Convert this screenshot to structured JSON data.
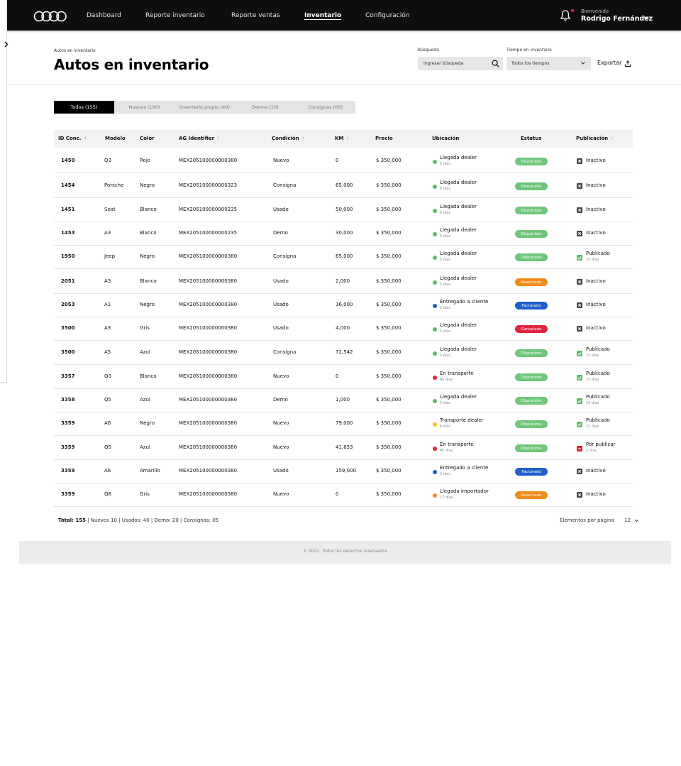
{
  "nav": {
    "items": [
      "Dashboard",
      "Reporte inventario",
      "Reporte ventas",
      "Inventario",
      "Configuración"
    ],
    "active": "Inventario",
    "welcome": "Bienvenido",
    "user_name": "Rodrigo Fernández"
  },
  "header": {
    "breadcrumb": "Autos en inventario",
    "title": "Autos en inventario",
    "search_label": "Búsqueda",
    "search_placeholder": "Ingresar búsqueda",
    "time_label": "Tiempo en inventario",
    "time_value": "Todos los tiempos",
    "export_label": "Exportar"
  },
  "tabs": [
    {
      "label": "Todos (155)",
      "active": true
    },
    {
      "label": "Nuevos (100)",
      "active": false
    },
    {
      "label": "Inventario propio (40)",
      "active": false
    },
    {
      "label": "Demos  (10)",
      "active": false
    },
    {
      "label": "Consignas  (05)",
      "active": false
    }
  ],
  "table": {
    "columns": [
      "ID Conc.",
      "Modelo",
      "Color",
      "AG Identifier",
      "Condición",
      "KM",
      "Precio",
      "Ubicación",
      "Estatus",
      "Publicación"
    ],
    "rows": [
      {
        "id": "1450",
        "modelo": "Q3",
        "color": "Rojo",
        "ag": "MEX205100000000380",
        "condicion": "Nuevo",
        "km": "0",
        "precio": "$ 350,000",
        "ubicacion": "Llegada dealer",
        "ubic_sub": "5 días",
        "ubic_color": "#5dbb63",
        "estatus": "Disponible",
        "estatus_color": "#70c67a",
        "pub": "Inactivo",
        "pub_sub": "",
        "pub_type": "inactive"
      },
      {
        "id": "1454",
        "modelo": "Porsche",
        "color": "Negro",
        "ag": "MEX205100000000323",
        "condicion": "Consigna",
        "km": "65,000",
        "precio": "$ 350,000",
        "ubicacion": "Llegada dealer",
        "ubic_sub": "5 días",
        "ubic_color": "#5dbb63",
        "estatus": "Disponible",
        "estatus_color": "#70c67a",
        "pub": "Inactivo",
        "pub_sub": "",
        "pub_type": "inactive"
      },
      {
        "id": "1451",
        "modelo": "Seat",
        "color": "Blanco",
        "ag": "MEX205100000000235",
        "condicion": "Usado",
        "km": "50,000",
        "precio": "$ 350,000",
        "ubicacion": "Llegada dealer",
        "ubic_sub": "5 días",
        "ubic_color": "#5dbb63",
        "estatus": "Disponible",
        "estatus_color": "#70c67a",
        "pub": "Inactivo",
        "pub_sub": "",
        "pub_type": "inactive"
      },
      {
        "id": "1453",
        "modelo": "A3",
        "color": "Blanco",
        "ag": "MEX205100000000235",
        "condicion": "Demo",
        "km": "30,000",
        "precio": "$ 350,000",
        "ubicacion": "Llegada dealer",
        "ubic_sub": "5 días",
        "ubic_color": "#5dbb63",
        "estatus": "Disponible",
        "estatus_color": "#70c67a",
        "pub": "Inactivo",
        "pub_sub": "",
        "pub_type": "inactive"
      },
      {
        "id": "1950",
        "modelo": "Jeep",
        "color": "Negro",
        "ag": "MEX205100000000380",
        "condicion": "Consigna",
        "km": "65,000",
        "precio": "$ 350,000",
        "ubicacion": "Llegada dealer",
        "ubic_sub": "5 días",
        "ubic_color": "#5dbb63",
        "estatus": "Disponible",
        "estatus_color": "#70c67a",
        "pub": "Publicado",
        "pub_sub": "15 días",
        "pub_type": "published"
      },
      {
        "id": "2051",
        "modelo": "A3",
        "color": "Blanco",
        "ag": "MEX205100000000380",
        "condicion": "Usado",
        "km": "2,000",
        "precio": "$ 350,000",
        "ubicacion": "Llegada dealer",
        "ubic_sub": "5 días",
        "ubic_color": "#5dbb63",
        "estatus": "Reservado",
        "estatus_color": "#f08c1b",
        "pub": "Inactivo",
        "pub_sub": "",
        "pub_type": "inactive"
      },
      {
        "id": "2053",
        "modelo": "A1",
        "color": "Negro",
        "ag": "MEX205100000000380",
        "condicion": "Usado",
        "km": "16,000",
        "precio": "$ 350,000",
        "ubicacion": "Entregado a cliente",
        "ubic_sub": "2 días",
        "ubic_color": "#1f5fc9",
        "estatus": "Facturado",
        "estatus_color": "#1f5fc9",
        "pub": "Inactivo",
        "pub_sub": "",
        "pub_type": "inactive"
      },
      {
        "id": "3500",
        "modelo": "A3",
        "color": "Gris",
        "ag": "MEX205100000000380",
        "condicion": "Usado",
        "km": "4,000",
        "precio": "$ 350,000",
        "ubicacion": "Llegada dealer",
        "ubic_sub": "5 días",
        "ubic_color": "#5dbb63",
        "estatus": "Cancelado",
        "estatus_color": "#e0243f",
        "pub": "Inactivo",
        "pub_sub": "",
        "pub_type": "inactive"
      },
      {
        "id": "3500",
        "modelo": "A5",
        "color": "Azul",
        "ag": "MEX205100000000380",
        "condicion": "Consigna",
        "km": "72,542",
        "precio": "$ 350,000",
        "ubicacion": "Llegada dealer",
        "ubic_sub": "5 días",
        "ubic_color": "#5dbb63",
        "estatus": "Disponible",
        "estatus_color": "#70c67a",
        "pub": "Publicado",
        "pub_sub": "15 días",
        "pub_type": "published"
      },
      {
        "id": "3357",
        "modelo": "Q3",
        "color": "Blanco",
        "ag": "MEX205100000000380",
        "condicion": "Nuevo",
        "km": "0",
        "precio": "$ 350,000",
        "ubicacion": "En transporte",
        "ubic_sub": "45 días",
        "ubic_color": "#e0243f",
        "estatus": "Disponible",
        "estatus_color": "#70c67a",
        "pub": "Publicado",
        "pub_sub": "15 días",
        "pub_type": "published"
      },
      {
        "id": "3358",
        "modelo": "Q5",
        "color": "Azul",
        "ag": "MEX205100000000380",
        "condicion": "Demo",
        "km": "1,000",
        "precio": "$ 350,000",
        "ubicacion": "Llegada dealer",
        "ubic_sub": "5 días",
        "ubic_color": "#5dbb63",
        "estatus": "Disponible",
        "estatus_color": "#70c67a",
        "pub": "Publicado",
        "pub_sub": "15 días",
        "pub_type": "published"
      },
      {
        "id": "3359",
        "modelo": "A6",
        "color": "Negro",
        "ag": "MEX205100000000380",
        "condicion": "Nuevo",
        "km": "79,000",
        "precio": "$ 350,000",
        "ubicacion": "Transporte dealer",
        "ubic_sub": "6 días",
        "ubic_color": "#f5c518",
        "estatus": "Disponible",
        "estatus_color": "#70c67a",
        "pub": "Publicado",
        "pub_sub": "15 días",
        "pub_type": "published"
      },
      {
        "id": "3359",
        "modelo": "Q5",
        "color": "Azul",
        "ag": "MEX205100000000380",
        "condicion": "Nuevo",
        "km": "41,653",
        "precio": "$ 350,000",
        "ubicacion": "En transporte",
        "ubic_sub": "45 días",
        "ubic_color": "#e0243f",
        "estatus": "Disponible",
        "estatus_color": "#70c67a",
        "pub": "Por publicar",
        "pub_sub": "2 días",
        "pub_type": "pending"
      },
      {
        "id": "3359",
        "modelo": "A6",
        "color": "Amarillo",
        "ag": "MEX205100000000380",
        "condicion": "Usado",
        "km": "159,000",
        "precio": "$ 350,000",
        "ubicacion": "Entregado a cliente",
        "ubic_sub": "2 días",
        "ubic_color": "#1f5fc9",
        "estatus": "Facturado",
        "estatus_color": "#1f5fc9",
        "pub": "Inactivo",
        "pub_sub": "",
        "pub_type": "inactive"
      },
      {
        "id": "3359",
        "modelo": "Q8",
        "color": "Gris",
        "ag": "MEX205100000000380",
        "condicion": "Nuevo",
        "km": "0",
        "precio": "$ 350,000",
        "ubicacion": "Llegada importador",
        "ubic_sub": "17 días",
        "ubic_color": "#f08c1b",
        "estatus": "Reservado",
        "estatus_color": "#f08c1b",
        "pub": "Inactivo",
        "pub_sub": "",
        "pub_type": "inactive"
      }
    ]
  },
  "footer": {
    "total_label": "Total: 155",
    "totals_rest": " | Nuevos 10 | Usados: 40 | Demo: 20 | Consignas: 05",
    "per_page_label": "Elementos por página",
    "per_page_value": "12",
    "copyright": "© 2021. Todos los derechos reservados"
  },
  "icons": {
    "pub_colors": {
      "inactive": "#444444",
      "published": "#5dbb63",
      "pending": "#e0243f"
    }
  }
}
